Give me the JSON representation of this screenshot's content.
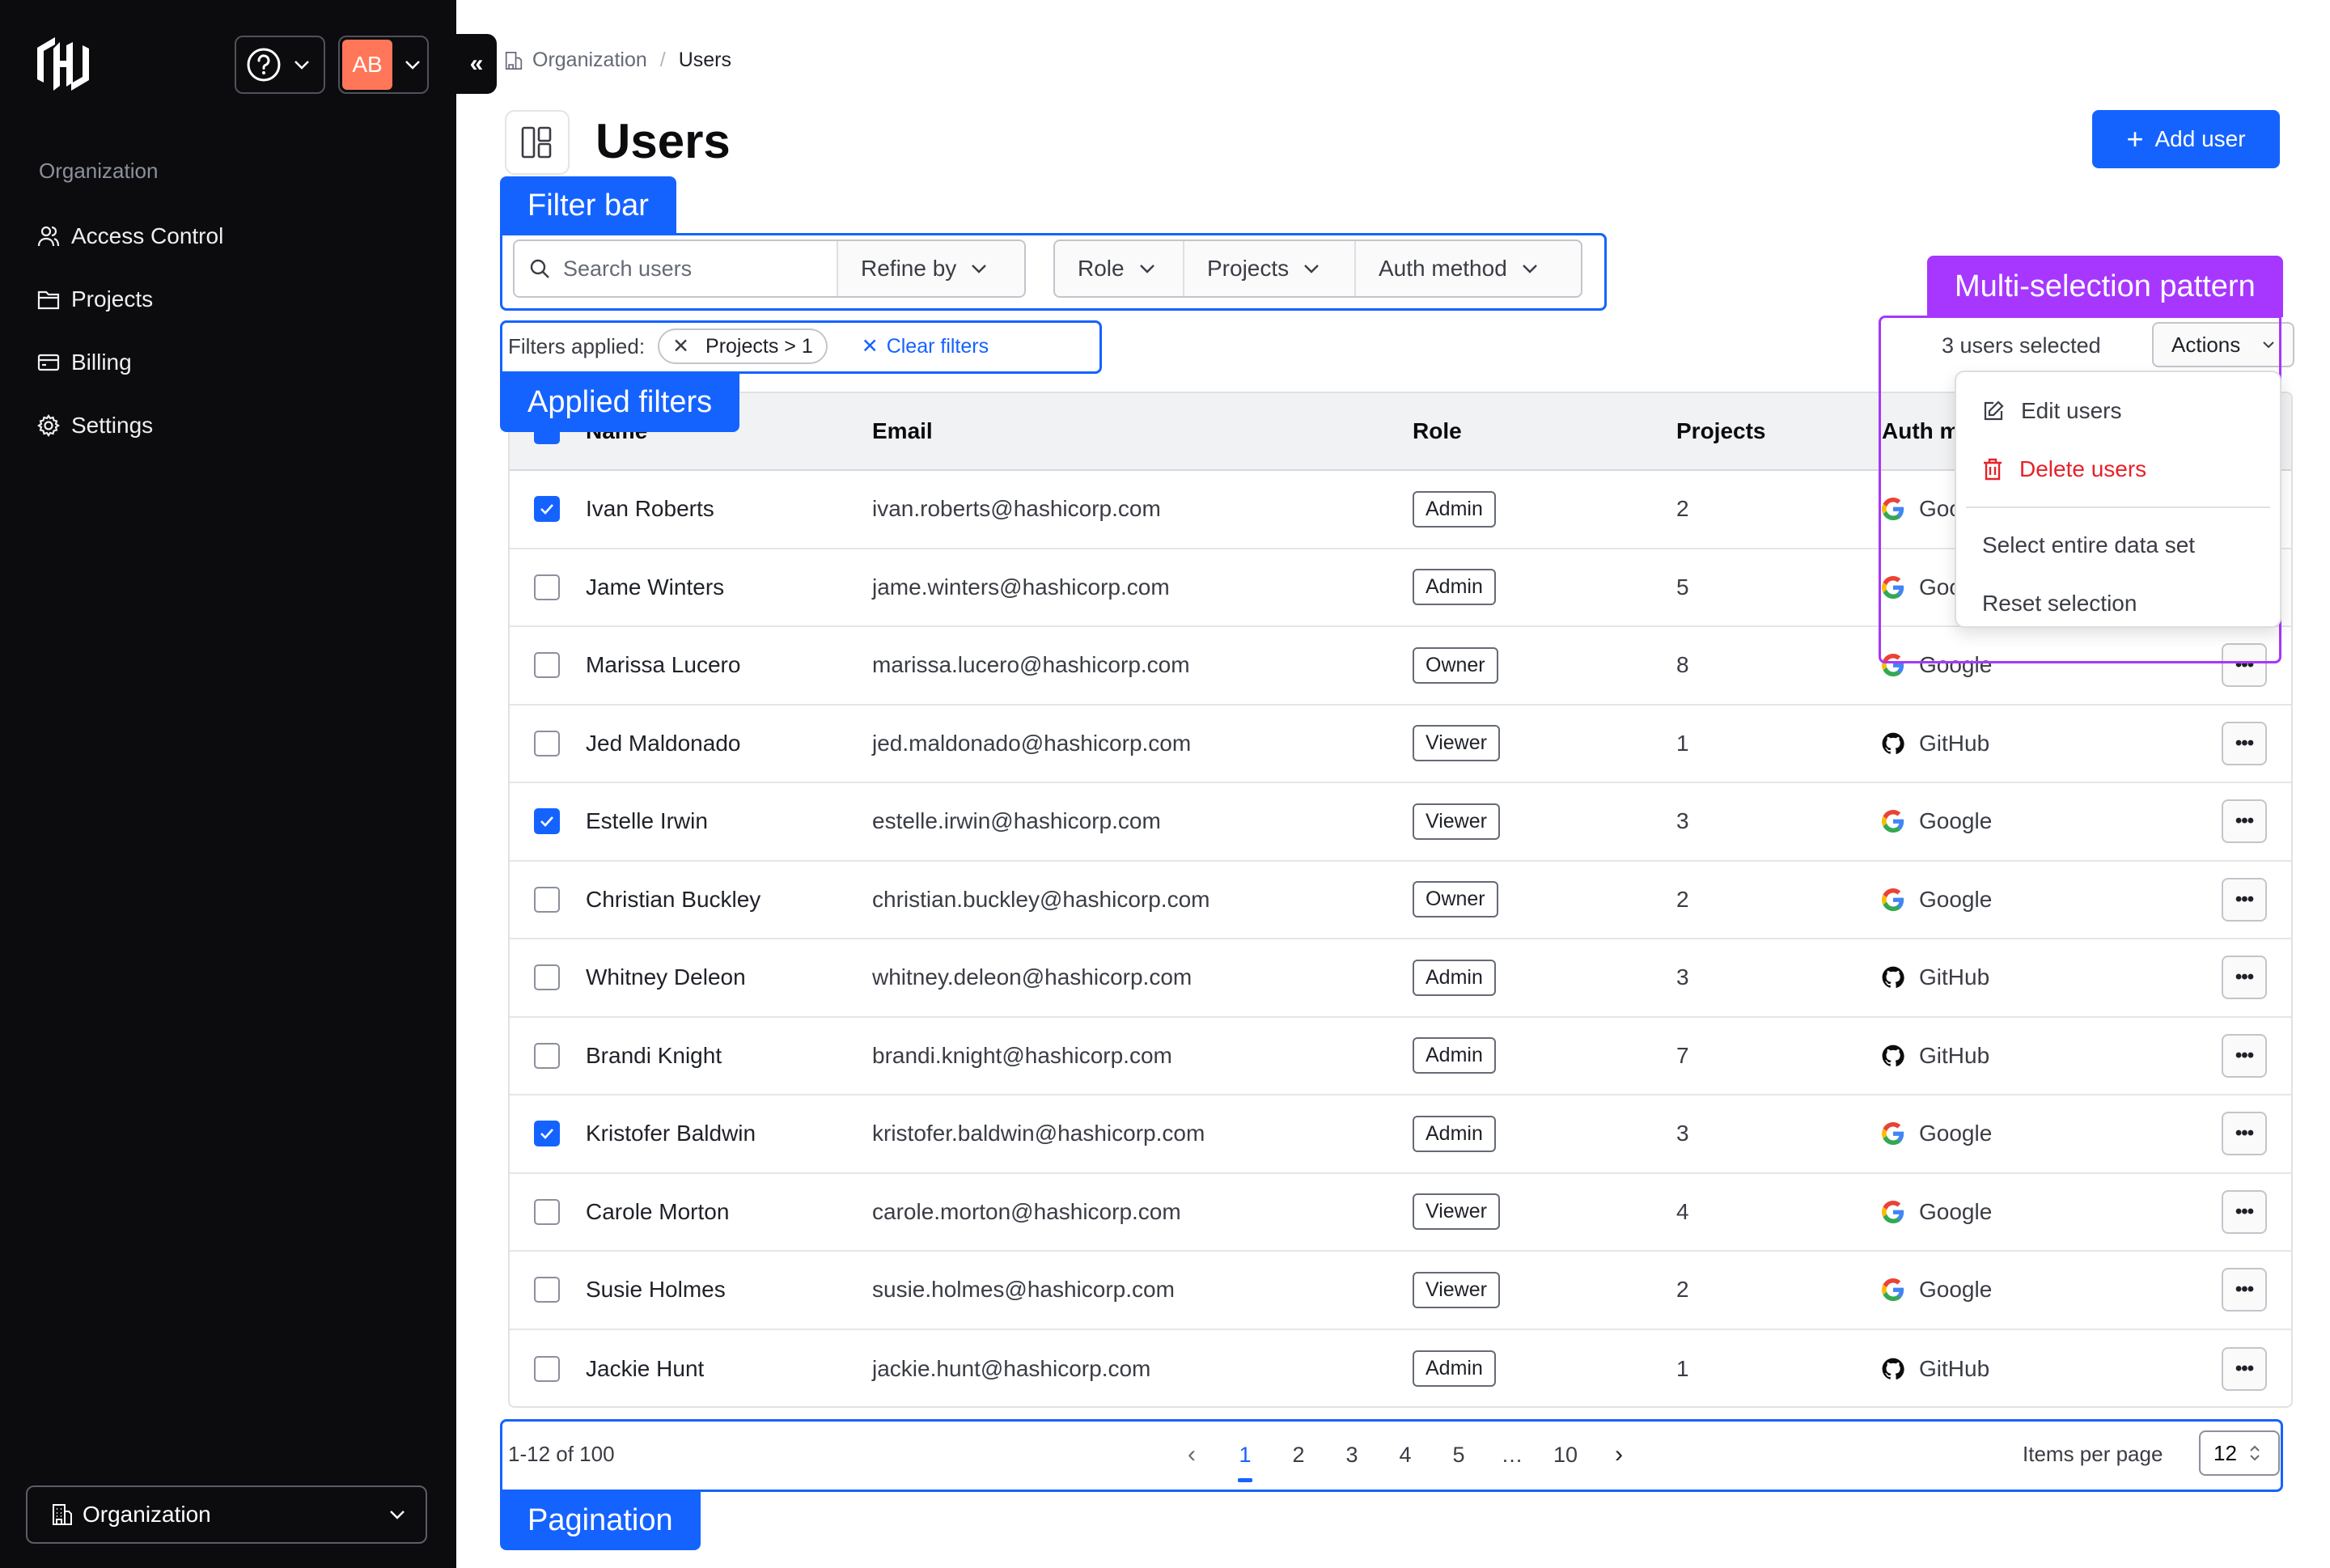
{
  "sidebar": {
    "logo": "hashicorp-logo",
    "help_icon": "question-circle-icon",
    "avatar_initials": "AB",
    "collapse_icon": "chevrons-left-icon",
    "section_label": "Organization",
    "items": [
      {
        "label": "Access Control",
        "icon": "users-icon"
      },
      {
        "label": "Projects",
        "icon": "folder-icon"
      },
      {
        "label": "Billing",
        "icon": "credit-card-icon"
      },
      {
        "label": "Settings",
        "icon": "gear-icon"
      }
    ],
    "org_switcher": "Organization"
  },
  "breadcrumb": {
    "parent": "Organization",
    "separator": "/",
    "current": "Users"
  },
  "header": {
    "title": "Users",
    "add_button": "Add user"
  },
  "annotations": {
    "filter_bar": "Filter bar",
    "applied_filters": "Applied filters",
    "multi_selection": "Multi-selection pattern",
    "pagination": "Pagination"
  },
  "filters": {
    "search_placeholder": "Search users",
    "search_value": "",
    "refine_by": "Refine by",
    "dropdowns": [
      "Role",
      "Projects",
      "Auth method"
    ],
    "applied_label": "Filters applied:",
    "applied_pills": [
      "Projects > 1"
    ],
    "clear_label": "Clear filters"
  },
  "selection": {
    "count_text": "3 users selected",
    "actions_label": "Actions",
    "menu": {
      "edit": "Edit users",
      "delete": "Delete users",
      "select_all": "Select entire data set",
      "reset": "Reset selection"
    }
  },
  "table": {
    "columns": [
      "Name",
      "Email",
      "Role",
      "Projects",
      "Auth method"
    ],
    "header_checkbox": "indeterminate",
    "rows": [
      {
        "selected": true,
        "name": "Ivan Roberts",
        "email": "ivan.roberts@hashicorp.com",
        "role": "Admin",
        "projects": "2",
        "auth": "Google"
      },
      {
        "selected": false,
        "name": "Jame Winters",
        "email": "jame.winters@hashicorp.com",
        "role": "Admin",
        "projects": "5",
        "auth": "Google"
      },
      {
        "selected": false,
        "name": "Marissa Lucero",
        "email": "marissa.lucero@hashicorp.com",
        "role": "Owner",
        "projects": "8",
        "auth": "Google"
      },
      {
        "selected": false,
        "name": "Jed Maldonado",
        "email": "jed.maldonado@hashicorp.com",
        "role": "Viewer",
        "projects": "1",
        "auth": "GitHub"
      },
      {
        "selected": true,
        "name": "Estelle Irwin",
        "email": "estelle.irwin@hashicorp.com",
        "role": "Viewer",
        "projects": "3",
        "auth": "Google"
      },
      {
        "selected": false,
        "name": "Christian Buckley",
        "email": "christian.buckley@hashicorp.com",
        "role": "Owner",
        "projects": "2",
        "auth": "Google"
      },
      {
        "selected": false,
        "name": "Whitney Deleon",
        "email": "whitney.deleon@hashicorp.com",
        "role": "Admin",
        "projects": "3",
        "auth": "GitHub"
      },
      {
        "selected": false,
        "name": "Brandi Knight",
        "email": "brandi.knight@hashicorp.com",
        "role": "Admin",
        "projects": "7",
        "auth": "GitHub"
      },
      {
        "selected": true,
        "name": "Kristofer Baldwin",
        "email": "kristofer.baldwin@hashicorp.com",
        "role": "Admin",
        "projects": "3",
        "auth": "Google"
      },
      {
        "selected": false,
        "name": "Carole Morton",
        "email": "carole.morton@hashicorp.com",
        "role": "Viewer",
        "projects": "4",
        "auth": "Google"
      },
      {
        "selected": false,
        "name": "Susie Holmes",
        "email": "susie.holmes@hashicorp.com",
        "role": "Viewer",
        "projects": "2",
        "auth": "Google"
      },
      {
        "selected": false,
        "name": "Jackie Hunt",
        "email": "jackie.hunt@hashicorp.com",
        "role": "Admin",
        "projects": "1",
        "auth": "GitHub"
      }
    ]
  },
  "pagination": {
    "range_text": "1-12 of 100",
    "pages": [
      "1",
      "2",
      "3",
      "4",
      "5",
      "…",
      "10"
    ],
    "current_page": "1",
    "items_per_page_label": "Items per page",
    "items_per_page": "12"
  },
  "colors": {
    "accent": "#1563ff",
    "annotation_purple": "#a737ff",
    "danger": "#e52228",
    "avatar": "#ff7658",
    "sidebar_bg": "#0c0c0e"
  }
}
